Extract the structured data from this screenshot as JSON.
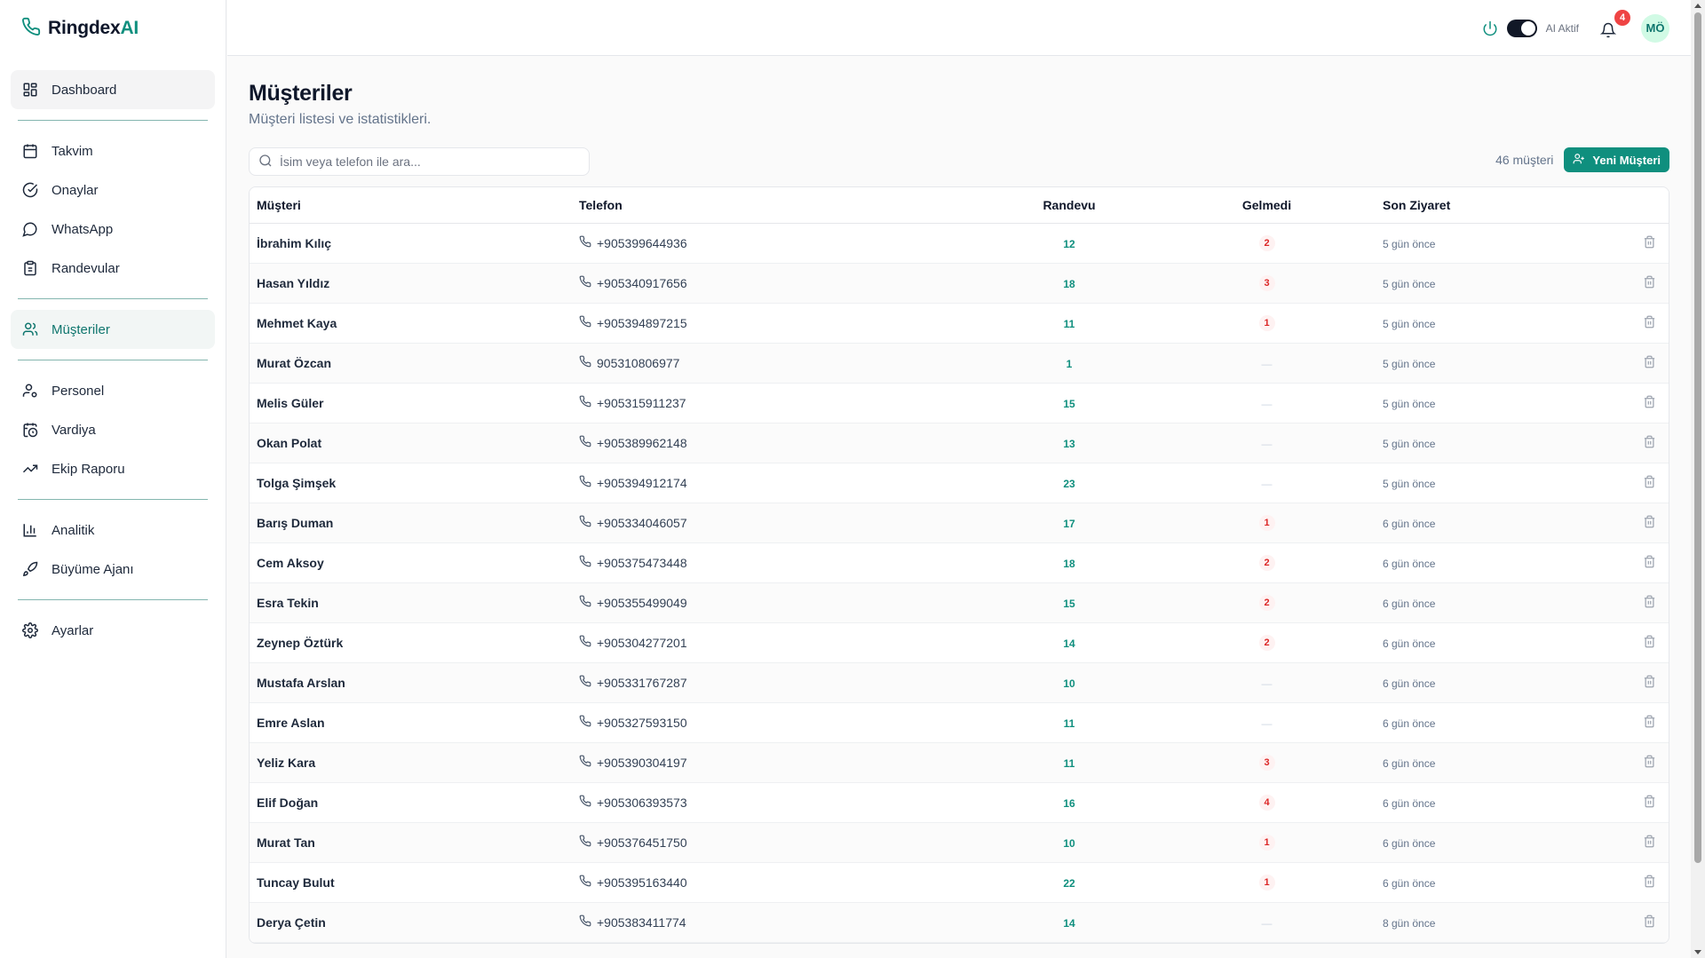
{
  "brand": {
    "name": "Ringdex",
    "suffix": "AI"
  },
  "sidebar": {
    "items": [
      {
        "label": "Dashboard",
        "icon": "dashboard-icon"
      },
      {
        "label": "Takvim",
        "icon": "calendar-icon"
      },
      {
        "label": "Onaylar",
        "icon": "check-circle-icon"
      },
      {
        "label": "WhatsApp",
        "icon": "message-circle-icon"
      },
      {
        "label": "Randevular",
        "icon": "clipboard-icon"
      },
      {
        "label": "Müşteriler",
        "icon": "users-icon"
      },
      {
        "label": "Personel",
        "icon": "user-cog-icon"
      },
      {
        "label": "Vardiya",
        "icon": "calendar-clock-icon"
      },
      {
        "label": "Ekip Raporu",
        "icon": "trending-up-icon"
      },
      {
        "label": "Analitik",
        "icon": "bar-chart-icon"
      },
      {
        "label": "Büyüme Ajanı",
        "icon": "rocket-icon"
      },
      {
        "label": "Ayarlar",
        "icon": "settings-icon"
      }
    ]
  },
  "topbar": {
    "ai_label": "AI Aktif",
    "notification_count": "4",
    "avatar_initials": "MÖ"
  },
  "page": {
    "title": "Müşteriler",
    "subtitle": "Müşteri listesi ve istatistikleri.",
    "search_placeholder": "İsim veya telefon ile ara...",
    "count_label": "46 müşteri",
    "new_button": "Yeni Müşteri"
  },
  "table": {
    "headers": {
      "name": "Müşteri",
      "phone": "Telefon",
      "appointments": "Randevu",
      "no_show": "Gelmedi",
      "last_visit": "Son Ziyaret"
    },
    "rows": [
      {
        "name": "İbrahim Kılıç",
        "phone": "+905399644936",
        "appointments": "12",
        "no_show": "2",
        "last_visit": "5 gün önce"
      },
      {
        "name": "Hasan Yıldız",
        "phone": "+905340917656",
        "appointments": "18",
        "no_show": "3",
        "last_visit": "5 gün önce"
      },
      {
        "name": "Mehmet Kaya",
        "phone": "+905394897215",
        "appointments": "11",
        "no_show": "1",
        "last_visit": "5 gün önce"
      },
      {
        "name": "Murat Özcan",
        "phone": "905310806977",
        "appointments": "1",
        "no_show": "—",
        "last_visit": "5 gün önce"
      },
      {
        "name": "Melis Güler",
        "phone": "+905315911237",
        "appointments": "15",
        "no_show": "—",
        "last_visit": "5 gün önce"
      },
      {
        "name": "Okan Polat",
        "phone": "+905389962148",
        "appointments": "13",
        "no_show": "—",
        "last_visit": "5 gün önce"
      },
      {
        "name": "Tolga Şimşek",
        "phone": "+905394912174",
        "appointments": "23",
        "no_show": "—",
        "last_visit": "5 gün önce"
      },
      {
        "name": "Barış Duman",
        "phone": "+905334046057",
        "appointments": "17",
        "no_show": "1",
        "last_visit": "6 gün önce"
      },
      {
        "name": "Cem Aksoy",
        "phone": "+905375473448",
        "appointments": "18",
        "no_show": "2",
        "last_visit": "6 gün önce"
      },
      {
        "name": "Esra Tekin",
        "phone": "+905355499049",
        "appointments": "15",
        "no_show": "2",
        "last_visit": "6 gün önce"
      },
      {
        "name": "Zeynep Öztürk",
        "phone": "+905304277201",
        "appointments": "14",
        "no_show": "2",
        "last_visit": "6 gün önce"
      },
      {
        "name": "Mustafa Arslan",
        "phone": "+905331767287",
        "appointments": "10",
        "no_show": "—",
        "last_visit": "6 gün önce"
      },
      {
        "name": "Emre Aslan",
        "phone": "+905327593150",
        "appointments": "11",
        "no_show": "—",
        "last_visit": "6 gün önce"
      },
      {
        "name": "Yeliz Kara",
        "phone": "+905390304197",
        "appointments": "11",
        "no_show": "3",
        "last_visit": "6 gün önce"
      },
      {
        "name": "Elif Doğan",
        "phone": "+905306393573",
        "appointments": "16",
        "no_show": "4",
        "last_visit": "6 gün önce"
      },
      {
        "name": "Murat Tan",
        "phone": "+905376451750",
        "appointments": "10",
        "no_show": "1",
        "last_visit": "6 gün önce"
      },
      {
        "name": "Tuncay Bulut",
        "phone": "+905395163440",
        "appointments": "22",
        "no_show": "1",
        "last_visit": "6 gün önce"
      },
      {
        "name": "Derya Çetin",
        "phone": "+905383411774",
        "appointments": "14",
        "no_show": "—",
        "last_visit": "8 gün önce"
      }
    ]
  },
  "colors": {
    "accent": "#0f8f7e",
    "danger": "#dc2626",
    "badge": "#ef4444"
  }
}
